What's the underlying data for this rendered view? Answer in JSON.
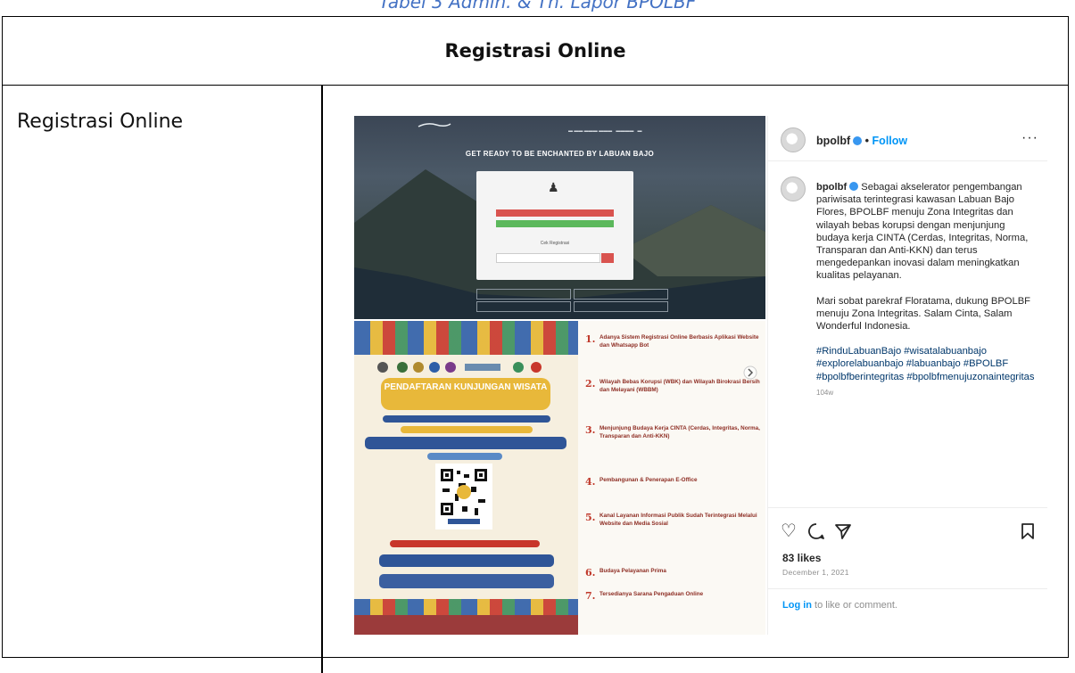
{
  "caption": "Tabel 3 Admin. & Tn. Lapor BPOLBF",
  "table": {
    "header": "Registrasi Online",
    "row_label": "Registrasi Online"
  },
  "website": {
    "hero_title": "GET READY TO BE ENCHANTED BY LABUAN BAJO",
    "register_label": "Cek Registrasi"
  },
  "poster": {
    "title": "PENDAFTARAN KUNJUNGAN WISATA"
  },
  "list": [
    {
      "num": "1.",
      "text": "Adanya Sistem Registrasi Online Berbasis Aplikasi Website dan Whatsapp Bot"
    },
    {
      "num": "2.",
      "text": "Wilayah Bebas Korupsi (WBK) dan Wilayah Birokrasi Bersih dan Melayani (WBBM)"
    },
    {
      "num": "3.",
      "text": "Menjunjung Budaya Kerja CINTA (Cerdas, Integritas, Norma, Transparan dan Anti-KKN)"
    },
    {
      "num": "4.",
      "text": "Pembangunan & Penerapan E-Office"
    },
    {
      "num": "5.",
      "text": "Kanal Layanan Informasi Publik Sudah Terintegrasi Melalui Website dan Media Sosial"
    },
    {
      "num": "6.",
      "text": "Budaya Pelayanan Prima"
    },
    {
      "num": "7.",
      "text": "Tersedianya Sarana Pengaduan Online"
    }
  ],
  "instagram": {
    "username": "bpolbf",
    "follow": "Follow",
    "dot_sep": "•",
    "more": "···",
    "caption_user": "bpolbf",
    "caption_p1": "Sebagai akselerator pengembangan pariwisata terintegrasi kawasan Labuan Bajo Flores, BPOLBF menuju Zona Integritas dan wilayah bebas korupsi dengan menjunjung budaya kerja CINTA (Cerdas, Integritas, Norma, Transparan dan Anti-KKN) dan terus mengedepankan inovasi dalam meningkatkan kualitas pelayanan.",
    "caption_p2": "Mari sobat parekraf Floratama, dukung BPOLBF menuju Zona Integritas. Salam Cinta, Salam Wonderful Indonesia.",
    "hashtags": "#RinduLabuanBajo #wisatalabuanbajo #explorelabuanbajo #labuanbajo #BPOLBF #bpolbfberintegritas #bpolbfmenujuzonaintegritas",
    "age": "104w",
    "likes": "83 likes",
    "date": "December 1, 2021",
    "login_link": "Log in",
    "login_rest": " to like or comment."
  }
}
